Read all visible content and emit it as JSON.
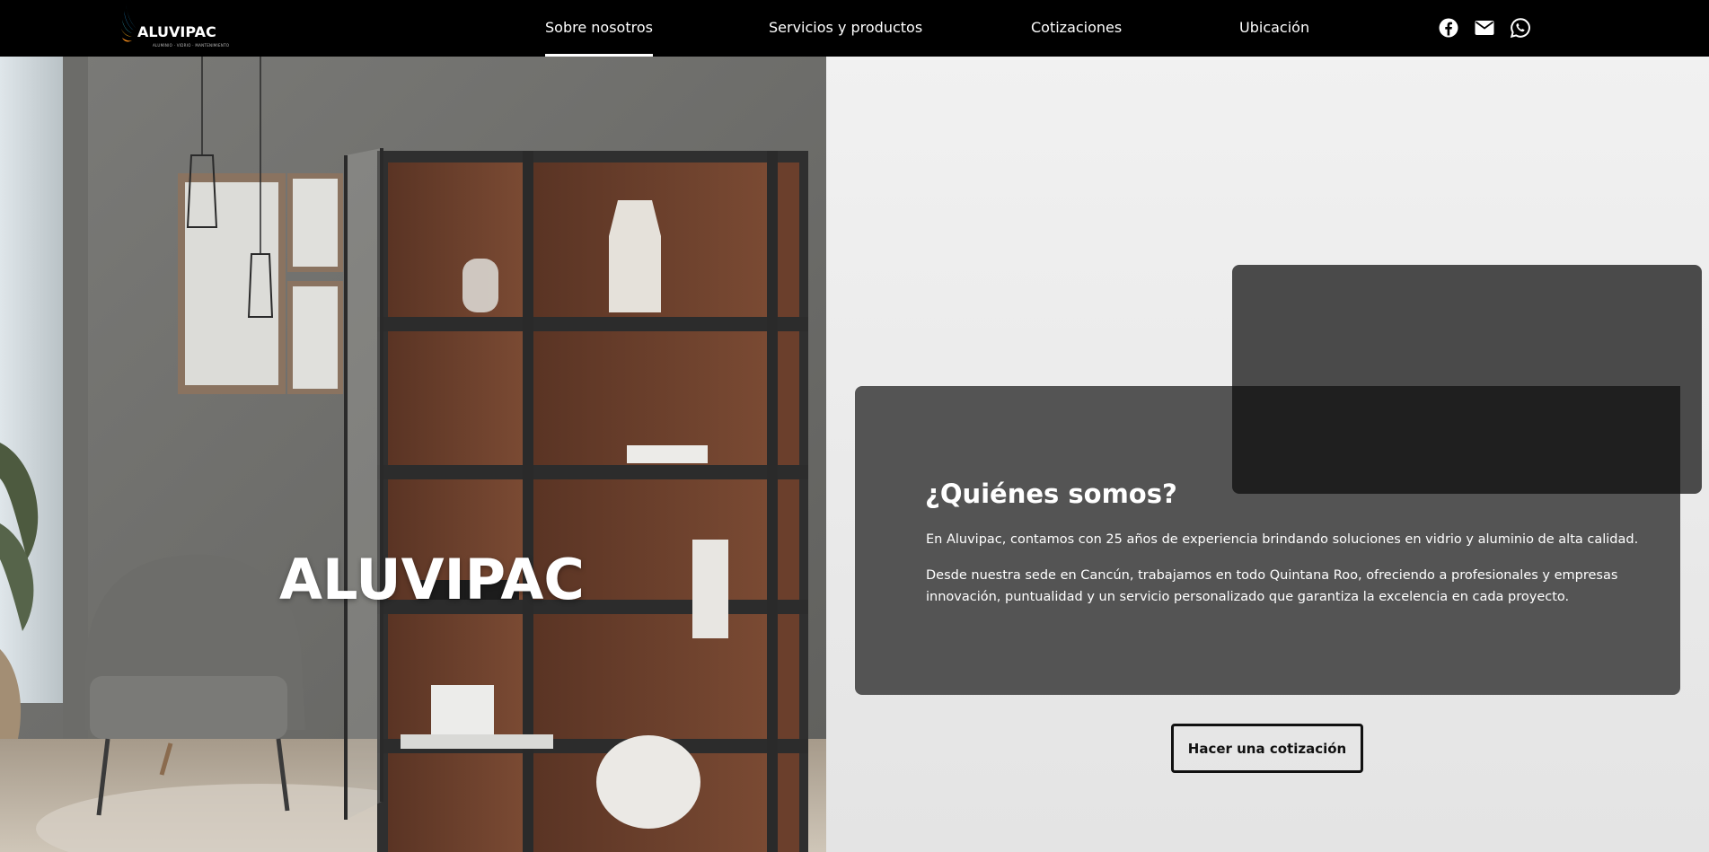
{
  "brand": {
    "name": "ALUVIPAC",
    "tagline": "ALUMINIO · VIDRIO · MANTENIMIENTO"
  },
  "nav": {
    "items": [
      {
        "label": "Sobre nosotros",
        "active": true
      },
      {
        "label": "Servicios y productos",
        "active": false
      },
      {
        "label": "Cotizaciones",
        "active": false
      },
      {
        "label": "Ubicación",
        "active": false
      }
    ],
    "social": [
      "facebook-icon",
      "mail-icon",
      "whatsapp-icon"
    ]
  },
  "hero": {
    "title": "ALUVIPAC",
    "image": "showroom-glass-cabinet"
  },
  "about": {
    "title": "¿Quiénes somos?",
    "p1": "En Aluvipac, contamos con 25 años de experiencia brindando soluciones en vidrio y aluminio de alta calidad.",
    "p2_line1": "Desde nuestra sede en Cancún, trabajamos en todo Quintana Roo, ofreciendo a profesionales y empresas",
    "p2_line2": "innovación, puntualidad y un servicio personalizado que garantiza la excelencia en cada proyecto."
  },
  "cta": {
    "label": "Hacer una cotización"
  },
  "colors": {
    "navbar": "#000000",
    "card": "#545454",
    "card_dark": "#1f1f1f",
    "panel_bg": "#ececec"
  }
}
